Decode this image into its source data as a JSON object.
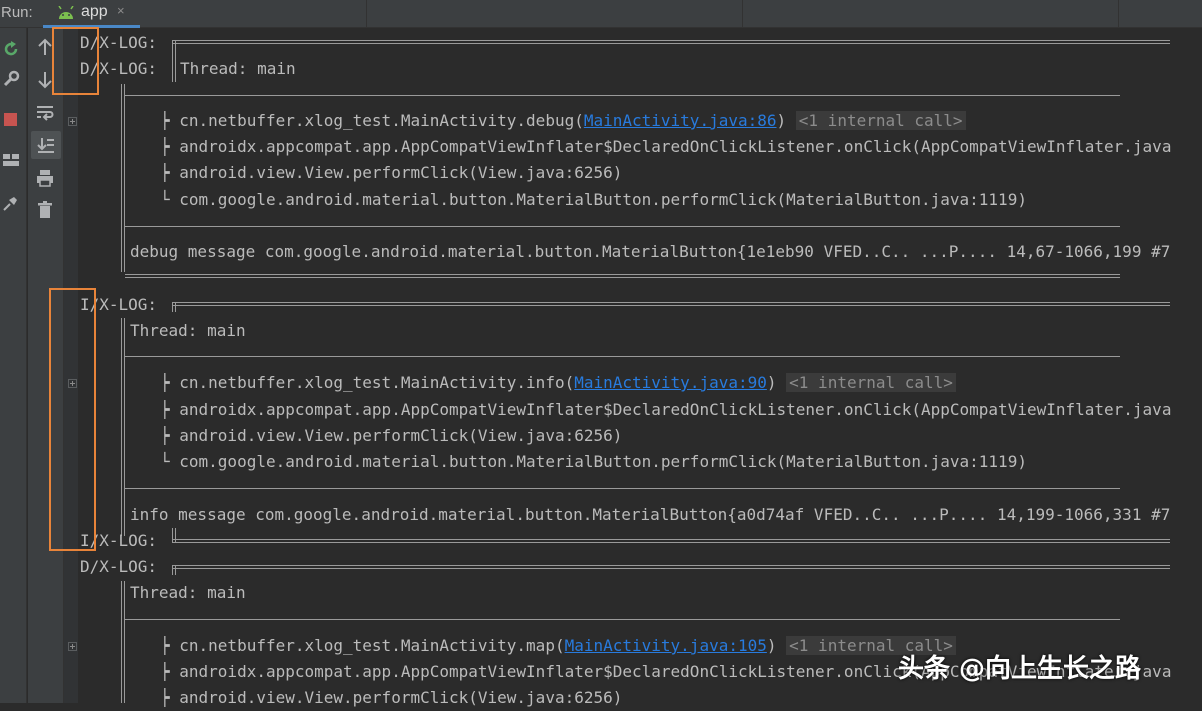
{
  "run": {
    "label": "Run:",
    "tab": {
      "label": "app",
      "close": "×",
      "icon": "android-icon"
    }
  },
  "sidebar_icons": [
    "rerun-icon",
    "wrench-icon",
    "stop-icon",
    "layout-icon",
    "pin-icon"
  ],
  "toolbar_icons": [
    "arrow-up-icon",
    "arrow-down-icon",
    "soft-wrap-icon",
    "scroll-to-end-icon",
    "print-icon",
    "trash-icon"
  ],
  "colors": {
    "link": "#287bde",
    "highlight_box": "#e8843a",
    "text": "#bbbbbb",
    "hint": "#8c8c8c"
  },
  "log": {
    "block1": {
      "tag1": "D/X-LOG:",
      "tag2": "D/X-LOG:",
      "thread": "Thread: main",
      "s1_pre": "┝ cn.netbuffer.xlog_test.MainActivity.debug(",
      "s1_link": "MainActivity.java:86",
      "s1_post": ")",
      "s1_hint": "<1 internal call>",
      "s2": "┝ androidx.appcompat.app.AppCompatViewInflater$DeclaredOnClickListener.onClick(AppCompatViewInflater.java",
      "s3": "┝ android.view.View.performClick(View.java:6256)",
      "s4": "└ com.google.android.material.button.MaterialButton.performClick(MaterialButton.java:1119)",
      "message": "debug message com.google.android.material.button.MaterialButton{1e1eb90 VFED..C.. ...P.... 14,67-1066,199 #7"
    },
    "block2": {
      "tag1": "I/X-LOG:",
      "thread": "Thread: main",
      "s1_pre": "┝ cn.netbuffer.xlog_test.MainActivity.info(",
      "s1_link": "MainActivity.java:90",
      "s1_post": ")",
      "s1_hint": "<1 internal call>",
      "s2": "┝ androidx.appcompat.app.AppCompatViewInflater$DeclaredOnClickListener.onClick(AppCompatViewInflater.java",
      "s3": "┝ android.view.View.performClick(View.java:6256)",
      "s4": "└ com.google.android.material.button.MaterialButton.performClick(MaterialButton.java:1119)",
      "message": "info message com.google.android.material.button.MaterialButton{a0d74af VFED..C.. ...P.... 14,199-1066,331 #7",
      "tag_end": "I/X-LOG:"
    },
    "block3": {
      "tag1": "D/X-LOG:",
      "thread": "Thread: main",
      "s1_pre": "┝ cn.netbuffer.xlog_test.MainActivity.map(",
      "s1_link": "MainActivity.java:105",
      "s1_post": ")",
      "s1_hint": "<1 internal call>",
      "s2": "┝ androidx.appcompat.app.AppCompatViewInflater$DeclaredOnClickListener.onClick(AppCompatViewInflater.java",
      "s3": "┝ android.view.View.performClick(View.java:6256)"
    }
  },
  "watermark": "头条 @向上生长之路"
}
